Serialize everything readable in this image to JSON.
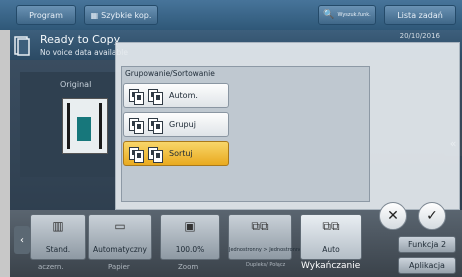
{
  "topbar": {
    "program_label": "Program",
    "quick_copy_label": "Szybkie kop.",
    "search_label": "Wyszuk.funk.",
    "job_list_label": "Lista zadań"
  },
  "status": {
    "title": "Ready to Copy",
    "subtitle": "No voice data available",
    "datetime": "20/10/2016"
  },
  "preview": {
    "original_label": "Original"
  },
  "dialog": {
    "title": "Grupowanie/Sortowanie",
    "options": [
      {
        "label": "Autom.",
        "selected": false
      },
      {
        "label": "Grupuj",
        "selected": false
      },
      {
        "label": "Sortuj",
        "selected": true
      }
    ],
    "cancel_label": "✕",
    "ok_label": "✓"
  },
  "toolbar": {
    "tools": [
      {
        "label": "Stand."
      },
      {
        "label": "Automatyczny"
      },
      {
        "label": "100.0%"
      },
      {
        "label": "Jednostronny > Jednostronne"
      },
      {
        "label": "Auto"
      }
    ],
    "categories": [
      "aczern.",
      "Papier",
      "Zoom",
      "Dupleks/ Połącz",
      "Wykańczanie"
    ],
    "function_label": "Funkcja 2",
    "apply_label": "Aplikacja"
  },
  "colors": {
    "accent_selected": "#f0c040",
    "topbar": "#3a6386"
  }
}
